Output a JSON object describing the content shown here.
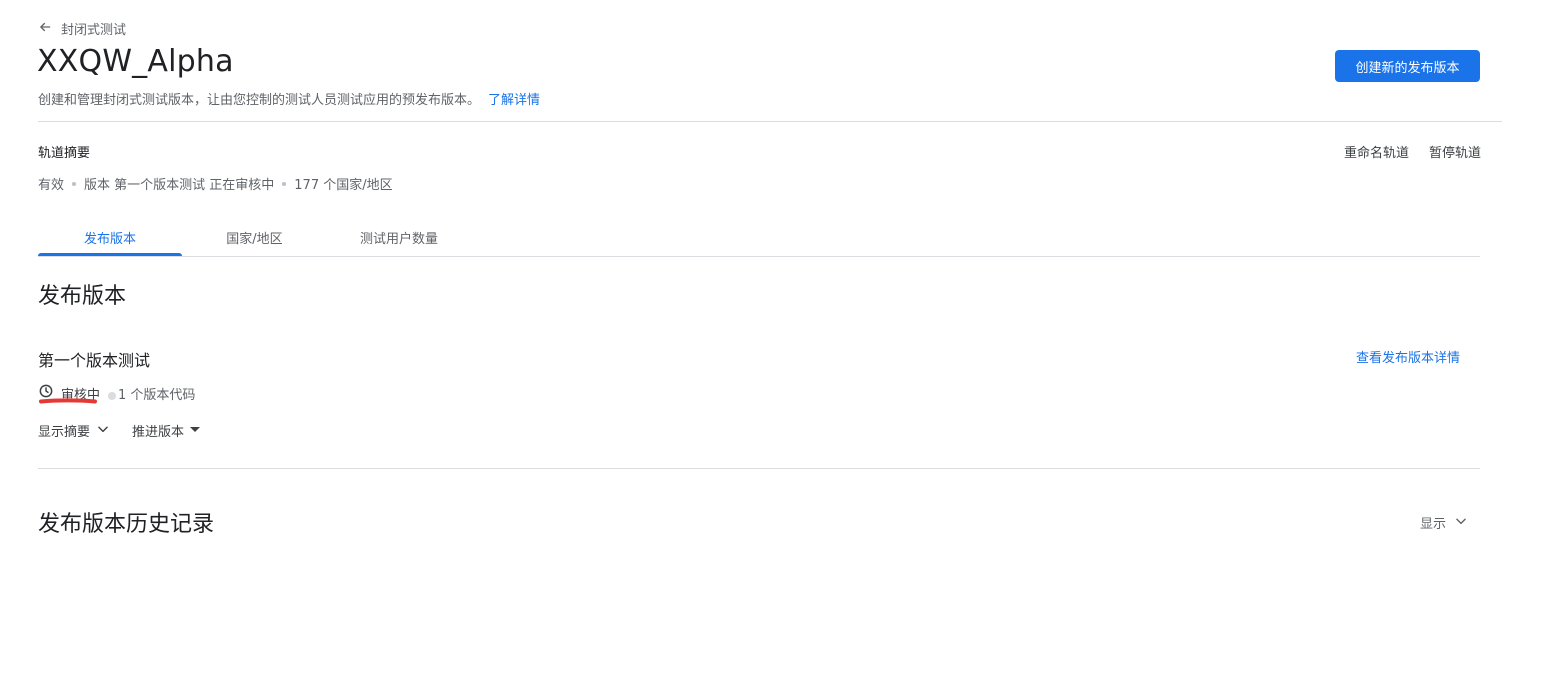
{
  "breadcrumb": {
    "back_label": "封闭式测试"
  },
  "header": {
    "title": "XXQW_Alpha",
    "subtitle": "创建和管理封闭式测试版本，让由您控制的测试人员测试应用的预发布版本。",
    "learn_more": "了解详情",
    "create_button": "创建新的发布版本"
  },
  "track_summary": {
    "label": "轨道摘要",
    "status": "有效",
    "release_info": "版本 第一个版本测试 正在审核中",
    "countries": "177 个国家/地区",
    "rename": "重命名轨道",
    "pause": "暂停轨道"
  },
  "tabs": [
    {
      "label": "发布版本",
      "active": true
    },
    {
      "label": "国家/地区",
      "active": false
    },
    {
      "label": "测试用户数量",
      "active": false
    }
  ],
  "releases": {
    "section_title": "发布版本",
    "release_name": "第一个版本测试",
    "view_details": "查看发布版本详情",
    "status": "审核中",
    "version_codes": "1 个版本代码",
    "show_summary": "显示摘要",
    "promote": "推进版本"
  },
  "history": {
    "title": "发布版本历史记录",
    "toggle": "显示"
  },
  "colors": {
    "accent": "#1a73e8",
    "annotation_red": "#e53935"
  },
  "icons": {
    "back": "arrow-left-icon",
    "clock": "clock-icon",
    "chevron": "chevron-down-icon",
    "caret": "caret-down-icon"
  }
}
